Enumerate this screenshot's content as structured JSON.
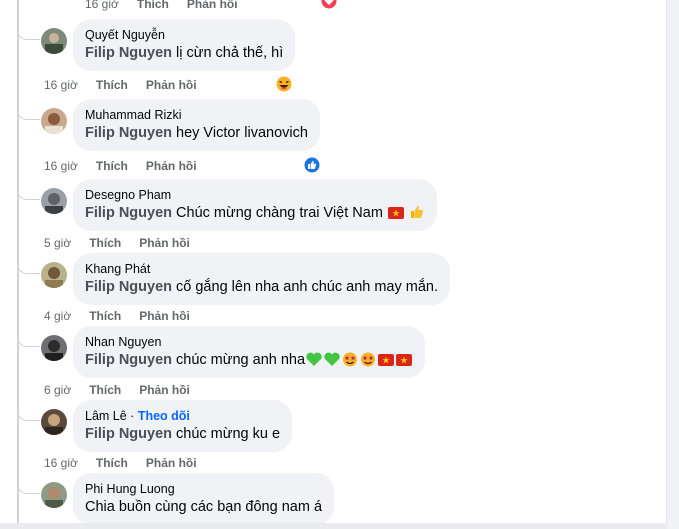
{
  "comments": [
    {
      "author": "Quyết Nguyễn",
      "follow": "",
      "tag": "Filip Nguyen",
      "text": " lị cừn chả thế, hì",
      "time": "16 giờ",
      "like": "Thích",
      "reply": "Phản hồi",
      "reaction": "laugh-reaction"
    },
    {
      "author": "Muhammad Rizki",
      "follow": "",
      "tag": "Filip Nguyen",
      "text": " hey Victor livanovich",
      "time": "16 giờ",
      "like": "Thích",
      "reply": "Phản hồi",
      "reaction": "like-reaction"
    },
    {
      "author": "Desegno Pham",
      "follow": "",
      "tag": "Filip Nguyen",
      "text": " Chúc mừng chàng trai Việt Nam",
      "time": "5 giờ",
      "like": "Thích",
      "reply": "Phản hồi"
    },
    {
      "author": "Khang Phát",
      "follow": "",
      "tag": "Filip Nguyen",
      "text": " cố gắng lên nha anh chúc anh may mắn.",
      "time": "4 giờ",
      "like": "Thích",
      "reply": "Phản hồi"
    },
    {
      "author": "Nhan Nguyen",
      "follow": "",
      "tag": "Filip Nguyen",
      "text": " chúc mừng anh nha",
      "time": "6 giờ",
      "like": "Thích",
      "reply": "Phản hồi"
    },
    {
      "author": "Lâm Lê",
      "follow": "Theo dõi",
      "tag": "Filip Nguyen",
      "text": " chúc mừng ku e",
      "time": "16 giờ",
      "like": "Thích",
      "reply": "Phản hồi"
    },
    {
      "author": "Phi Hung Luong",
      "follow": "",
      "tag": "",
      "text": "Chia buồn cùng các bạn đông nam á",
      "time": "",
      "like": "",
      "reply": ""
    }
  ],
  "top_actions": {
    "time": "16 giờ",
    "like": "Thích",
    "reply": "Phản hồi"
  },
  "colors": {
    "bubble": "#f0f2f5",
    "link": "#0866ff",
    "meta": "#65676b"
  }
}
